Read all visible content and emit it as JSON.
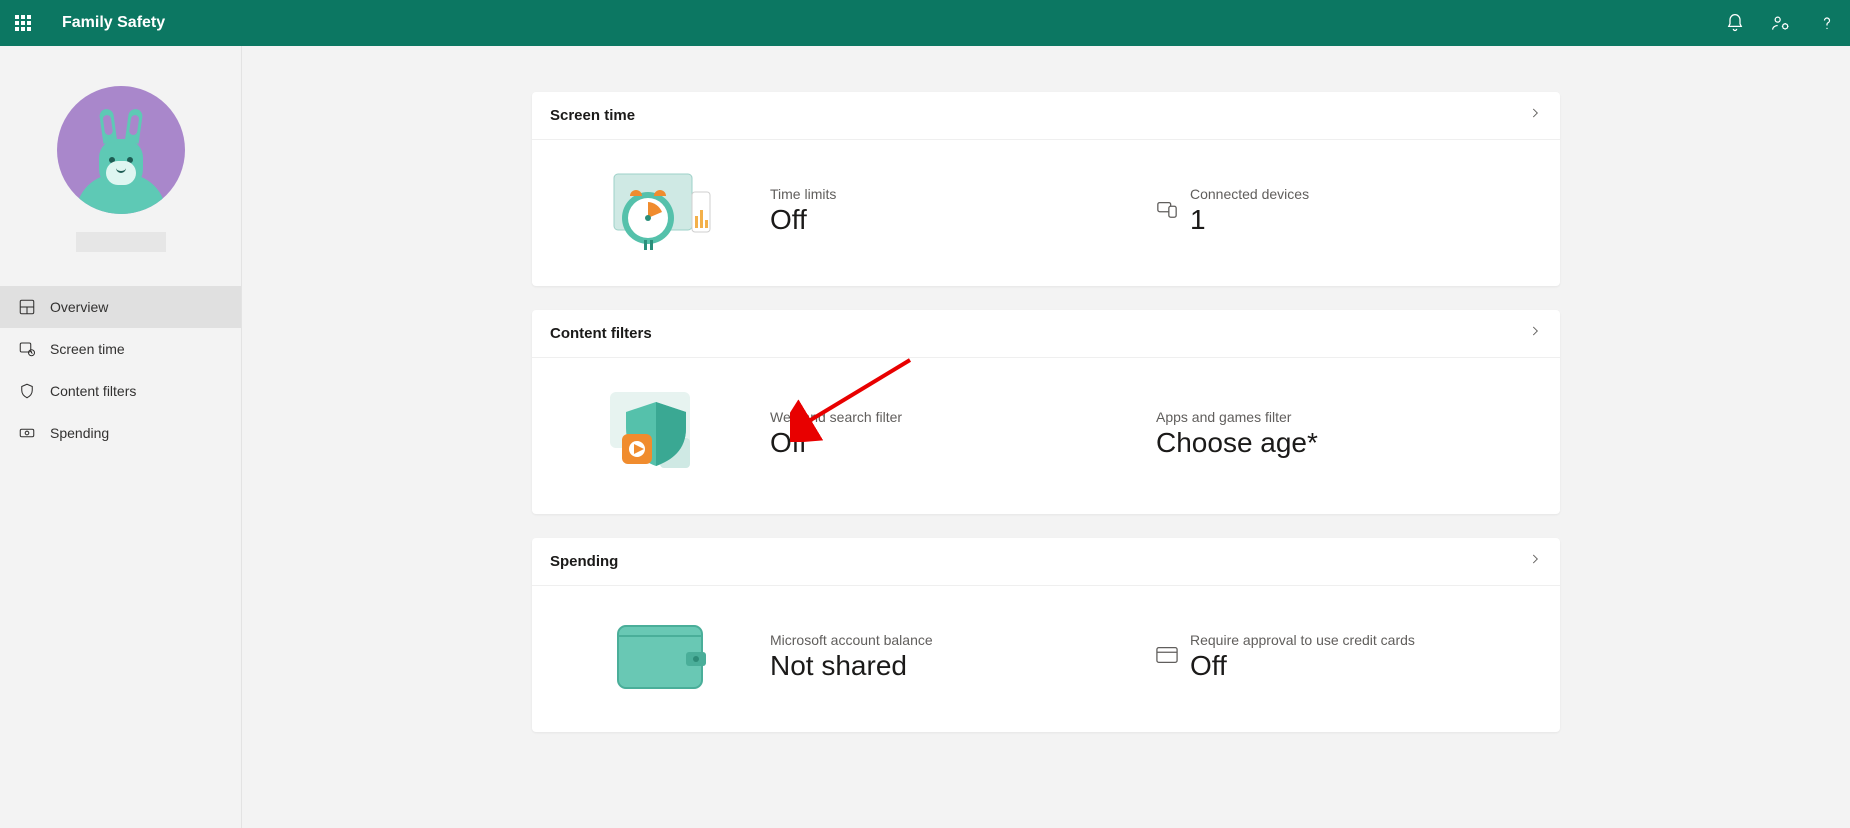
{
  "header": {
    "title": "Family Safety"
  },
  "sidebar": {
    "items": [
      {
        "label": "Overview"
      },
      {
        "label": "Screen time"
      },
      {
        "label": "Content filters"
      },
      {
        "label": "Spending"
      }
    ]
  },
  "cards": {
    "screen_time": {
      "title": "Screen time",
      "time_limits_label": "Time limits",
      "time_limits_value": "Off",
      "devices_label": "Connected devices",
      "devices_value": "1"
    },
    "content_filters": {
      "title": "Content filters",
      "web_label": "Web and search filter",
      "web_value": "Off",
      "apps_label": "Apps and games filter",
      "apps_value": "Choose age*"
    },
    "spending": {
      "title": "Spending",
      "balance_label": "Microsoft account balance",
      "balance_value": "Not shared",
      "approval_label": "Require approval to use credit cards",
      "approval_value": "Off"
    }
  }
}
